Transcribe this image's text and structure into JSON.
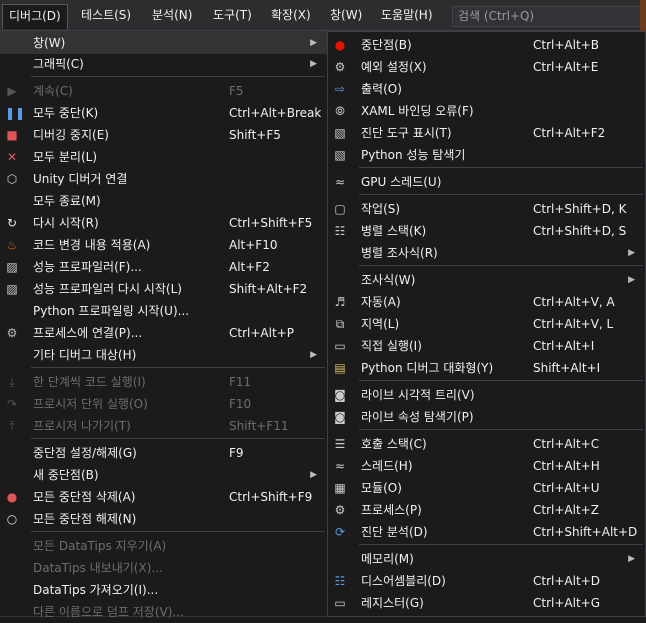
{
  "menubar": {
    "items": [
      "디버그(D)",
      "테스트(S)",
      "분석(N)",
      "도구(T)",
      "확장(X)",
      "창(W)",
      "도움말(H)"
    ],
    "search_placeholder": "검색 (Ctrl+Q)"
  },
  "debug_menu": [
    {
      "label": "창(W)",
      "shortcut": "",
      "submenu": true,
      "icon": "",
      "disabled": false
    },
    {
      "label": "그래픽(C)",
      "shortcut": "",
      "submenu": true,
      "icon": "",
      "disabled": false
    },
    {
      "label": "계속(C)",
      "shortcut": "F5",
      "icon": "play-icon",
      "disabled": true
    },
    {
      "label": "모두 중단(K)",
      "shortcut": "Ctrl+Alt+Break",
      "icon": "pause-icon",
      "disabled": false
    },
    {
      "label": "디버깅 중지(E)",
      "shortcut": "Shift+F5",
      "icon": "stop-icon",
      "disabled": false
    },
    {
      "label": "모두 분리(L)",
      "shortcut": "",
      "icon": "detach-x-icon",
      "disabled": false
    },
    {
      "label": "Unity 디버거 연결",
      "shortcut": "",
      "icon": "unity-cube-icon",
      "disabled": false
    },
    {
      "label": "모두 종료(M)",
      "shortcut": "",
      "icon": "",
      "disabled": false
    },
    {
      "label": "다시 시작(R)",
      "shortcut": "Ctrl+Shift+F5",
      "icon": "restart-icon",
      "disabled": false
    },
    {
      "label": "코드 변경 내용 적용(A)",
      "shortcut": "Alt+F10",
      "icon": "hot-reload-flame-icon",
      "disabled": false
    },
    {
      "label": "성능 프로파일러(F)...",
      "shortcut": "Alt+F2",
      "icon": "profiler-icon",
      "disabled": false
    },
    {
      "label": "성능 프로파일러 다시 시작(L)",
      "shortcut": "Shift+Alt+F2",
      "icon": "profiler-restart-icon",
      "disabled": false
    },
    {
      "label": "Python 프로파일링 시작(U)...",
      "shortcut": "",
      "icon": "",
      "disabled": false
    },
    {
      "label": "프로세스에 연결(P)...",
      "shortcut": "Ctrl+Alt+P",
      "icon": "attach-gears-icon",
      "disabled": false
    },
    {
      "label": "기타 디버그 대상(H)",
      "shortcut": "",
      "submenu": true,
      "icon": "",
      "disabled": false
    },
    {
      "label": "한 단계씩 코드 실행(I)",
      "shortcut": "F11",
      "icon": "step-into-icon",
      "disabled": true
    },
    {
      "label": "프로시저 단위 실행(O)",
      "shortcut": "F10",
      "icon": "step-over-icon",
      "disabled": true
    },
    {
      "label": "프로시저 나가기(T)",
      "shortcut": "Shift+F11",
      "icon": "step-out-icon",
      "disabled": true
    },
    {
      "label": "중단점 설정/해제(G)",
      "shortcut": "F9",
      "icon": "",
      "disabled": false
    },
    {
      "label": "새 중단점(B)",
      "shortcut": "",
      "submenu": true,
      "icon": "",
      "disabled": false
    },
    {
      "label": "모든 중단점 삭제(A)",
      "shortcut": "Ctrl+Shift+F9",
      "icon": "delete-breakpoints-icon",
      "disabled": false
    },
    {
      "label": "모든 중단점 해제(N)",
      "shortcut": "",
      "icon": "disable-breakpoints-icon",
      "disabled": false
    },
    {
      "label": "모든 DataTips 지우기(A)",
      "shortcut": "",
      "icon": "",
      "disabled": true
    },
    {
      "label": "DataTips 내보내기(X)...",
      "shortcut": "",
      "icon": "",
      "disabled": true
    },
    {
      "label": "DataTips 가져오기(I)...",
      "shortcut": "",
      "icon": "",
      "disabled": false
    },
    {
      "label": "다른 이름으로 덤프 저장(V)...",
      "shortcut": "",
      "icon": "",
      "disabled": true
    }
  ],
  "window_submenu": [
    {
      "label": "중단점(B)",
      "shortcut": "Ctrl+Alt+B",
      "icon": "breakpoints-icon"
    },
    {
      "label": "예외 설정(X)",
      "shortcut": "Ctrl+Alt+E",
      "icon": "exception-settings-icon"
    },
    {
      "label": "출력(O)",
      "shortcut": "",
      "icon": "output-icon"
    },
    {
      "label": "XAML 바인딩 오류(F)",
      "shortcut": "",
      "icon": "xaml-binding-icon"
    },
    {
      "label": "진단 도구 표시(T)",
      "shortcut": "Ctrl+Alt+F2",
      "icon": "diagnostic-tools-icon"
    },
    {
      "label": "Python 성능 탐색기",
      "shortcut": "",
      "icon": "python-perf-icon"
    },
    {
      "label": "GPU 스레드(U)",
      "shortcut": "",
      "icon": "gpu-threads-icon"
    },
    {
      "label": "작업(S)",
      "shortcut": "Ctrl+Shift+D, K",
      "icon": "tasks-icon"
    },
    {
      "label": "병렬 스택(K)",
      "shortcut": "Ctrl+Shift+D, S",
      "icon": "parallel-stacks-icon"
    },
    {
      "label": "병렬 조사식(R)",
      "shortcut": "",
      "icon": "",
      "submenu": true
    },
    {
      "label": "조사식(W)",
      "shortcut": "",
      "icon": "",
      "submenu": true
    },
    {
      "label": "자동(A)",
      "shortcut": "Ctrl+Alt+V, A",
      "icon": "autos-icon"
    },
    {
      "label": "지역(L)",
      "shortcut": "Ctrl+Alt+V, L",
      "icon": "locals-icon"
    },
    {
      "label": "직접 실행(I)",
      "shortcut": "Ctrl+Alt+I",
      "icon": "immediate-icon"
    },
    {
      "label": "Python 디버그 대화형(Y)",
      "shortcut": "Shift+Alt+I",
      "icon": "python-interactive-icon"
    },
    {
      "label": "라이브 시각적 트리(V)",
      "shortcut": "",
      "icon": "live-visual-tree-icon"
    },
    {
      "label": "라이브 속성 탐색기(P)",
      "shortcut": "",
      "icon": "live-property-icon"
    },
    {
      "label": "호출 스택(C)",
      "shortcut": "Ctrl+Alt+C",
      "icon": "call-stack-icon"
    },
    {
      "label": "스레드(H)",
      "shortcut": "Ctrl+Alt+H",
      "icon": "threads-icon"
    },
    {
      "label": "모듈(O)",
      "shortcut": "Ctrl+Alt+U",
      "icon": "modules-icon"
    },
    {
      "label": "프로세스(P)",
      "shortcut": "Ctrl+Alt+Z",
      "icon": "processes-icon"
    },
    {
      "label": "진단 분석(D)",
      "shortcut": "Ctrl+Shift+Alt+D",
      "icon": "diagnostic-analysis-icon"
    },
    {
      "label": "메모리(M)",
      "shortcut": "",
      "icon": "",
      "submenu": true
    },
    {
      "label": "디스어셈블리(D)",
      "shortcut": "Ctrl+Alt+D",
      "icon": "disassembly-icon"
    },
    {
      "label": "레지스터(G)",
      "shortcut": "Ctrl+Alt+G",
      "icon": "registers-icon"
    }
  ]
}
